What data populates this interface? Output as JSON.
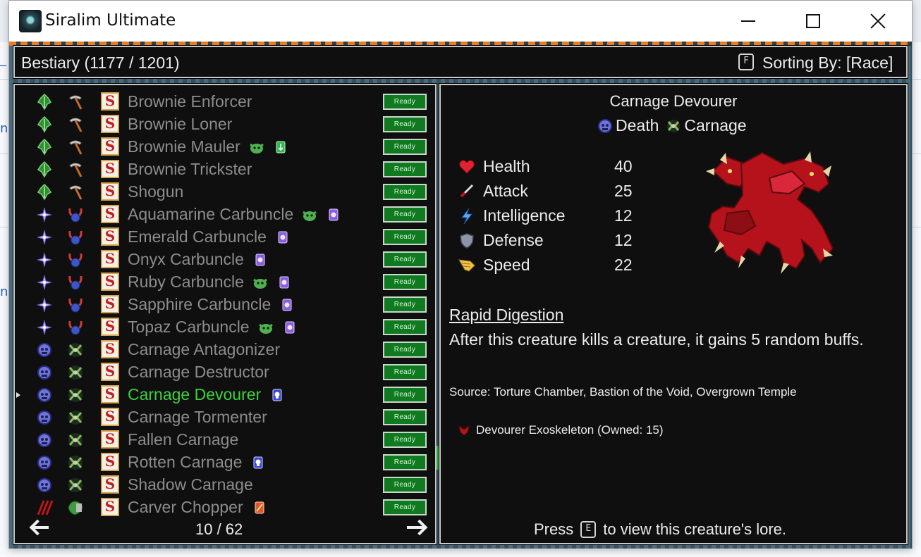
{
  "window": {
    "title": "Siralim Ultimate"
  },
  "background": {
    "links": [
      "_",
      "n",
      "n"
    ]
  },
  "header": {
    "title": "Bestiary (1177 / 1201)",
    "sort_key": "F",
    "sort_label": "Sorting By: [Race]"
  },
  "list": {
    "ready_label": "Ready",
    "page": "10 / 62",
    "rows": [
      {
        "name": "Brownie Enforcer",
        "race": "leaf",
        "class": "pick",
        "badges": [],
        "selected": false
      },
      {
        "name": "Brownie Loner",
        "race": "leaf",
        "class": "pick",
        "badges": [],
        "selected": false
      },
      {
        "name": "Brownie Mauler",
        "race": "leaf",
        "class": "pick",
        "badges": [
          "green-goblin",
          "green-card"
        ],
        "selected": false
      },
      {
        "name": "Brownie Trickster",
        "race": "leaf",
        "class": "pick",
        "badges": [],
        "selected": false
      },
      {
        "name": "Shogun",
        "race": "leaf",
        "class": "pick",
        "badges": [],
        "selected": false
      },
      {
        "name": "Aquamarine Carbuncle",
        "race": "sparkle",
        "class": "horns",
        "badges": [
          "green-goblin",
          "purple-card"
        ],
        "selected": false
      },
      {
        "name": "Emerald Carbuncle",
        "race": "sparkle",
        "class": "horns",
        "badges": [
          "purple-card"
        ],
        "selected": false
      },
      {
        "name": "Onyx Carbuncle",
        "race": "sparkle",
        "class": "horns",
        "badges": [
          "purple-card"
        ],
        "selected": false
      },
      {
        "name": "Ruby Carbuncle",
        "race": "sparkle",
        "class": "horns",
        "badges": [
          "green-goblin",
          "purple-card"
        ],
        "selected": false
      },
      {
        "name": "Sapphire Carbuncle",
        "race": "sparkle",
        "class": "horns",
        "badges": [
          "purple-card"
        ],
        "selected": false
      },
      {
        "name": "Topaz Carbuncle",
        "race": "sparkle",
        "class": "horns",
        "badges": [
          "green-goblin",
          "purple-card"
        ],
        "selected": false
      },
      {
        "name": "Carnage Antagonizer",
        "race": "death",
        "class": "carnage",
        "badges": [],
        "selected": false
      },
      {
        "name": "Carnage Destructor",
        "race": "death",
        "class": "carnage",
        "badges": [],
        "selected": false
      },
      {
        "name": "Carnage Devourer",
        "race": "death",
        "class": "carnage",
        "badges": [
          "blue-card"
        ],
        "selected": true
      },
      {
        "name": "Carnage Tormenter",
        "race": "death",
        "class": "carnage",
        "badges": [],
        "selected": false
      },
      {
        "name": "Fallen Carnage",
        "race": "death",
        "class": "carnage",
        "badges": [],
        "selected": false
      },
      {
        "name": "Rotten Carnage",
        "race": "death",
        "class": "carnage",
        "badges": [
          "blue-card"
        ],
        "selected": false
      },
      {
        "name": "Shadow Carnage",
        "race": "death",
        "class": "carnage",
        "badges": [],
        "selected": false
      },
      {
        "name": "Carver Chopper",
        "race": "claw",
        "class": "green-head",
        "badges": [
          "orange-card"
        ],
        "selected": false
      }
    ]
  },
  "detail": {
    "name": "Carnage Devourer",
    "types": [
      {
        "label": "Death",
        "icon": "death-icon"
      },
      {
        "label": "Carnage",
        "icon": "carnage-icon"
      }
    ],
    "stats": [
      {
        "label": "Health",
        "value": "40",
        "icon": "heart-icon"
      },
      {
        "label": "Attack",
        "value": "25",
        "icon": "sword-icon"
      },
      {
        "label": "Intelligence",
        "value": "12",
        "icon": "lightning-icon"
      },
      {
        "label": "Defense",
        "value": "12",
        "icon": "shield-icon"
      },
      {
        "label": "Speed",
        "value": "22",
        "icon": "wing-icon"
      }
    ],
    "trait_name": "Rapid Digestion",
    "trait_desc": "After this creature kills a creature, it gains 5 random buffs.",
    "source": "Source: Torture Chamber, Bastion of the Void, Overgrown Temple",
    "item": "Devourer Exoskeleton (Owned: 15)",
    "lore_prefix": "Press",
    "lore_key": "E",
    "lore_suffix": "to view this creature's lore."
  },
  "colors": {
    "ready_bg": "#0f7a1f",
    "selected_name": "#3dd23d",
    "name": "#8c8c8c",
    "panel_bg": "#0f0f0f"
  }
}
